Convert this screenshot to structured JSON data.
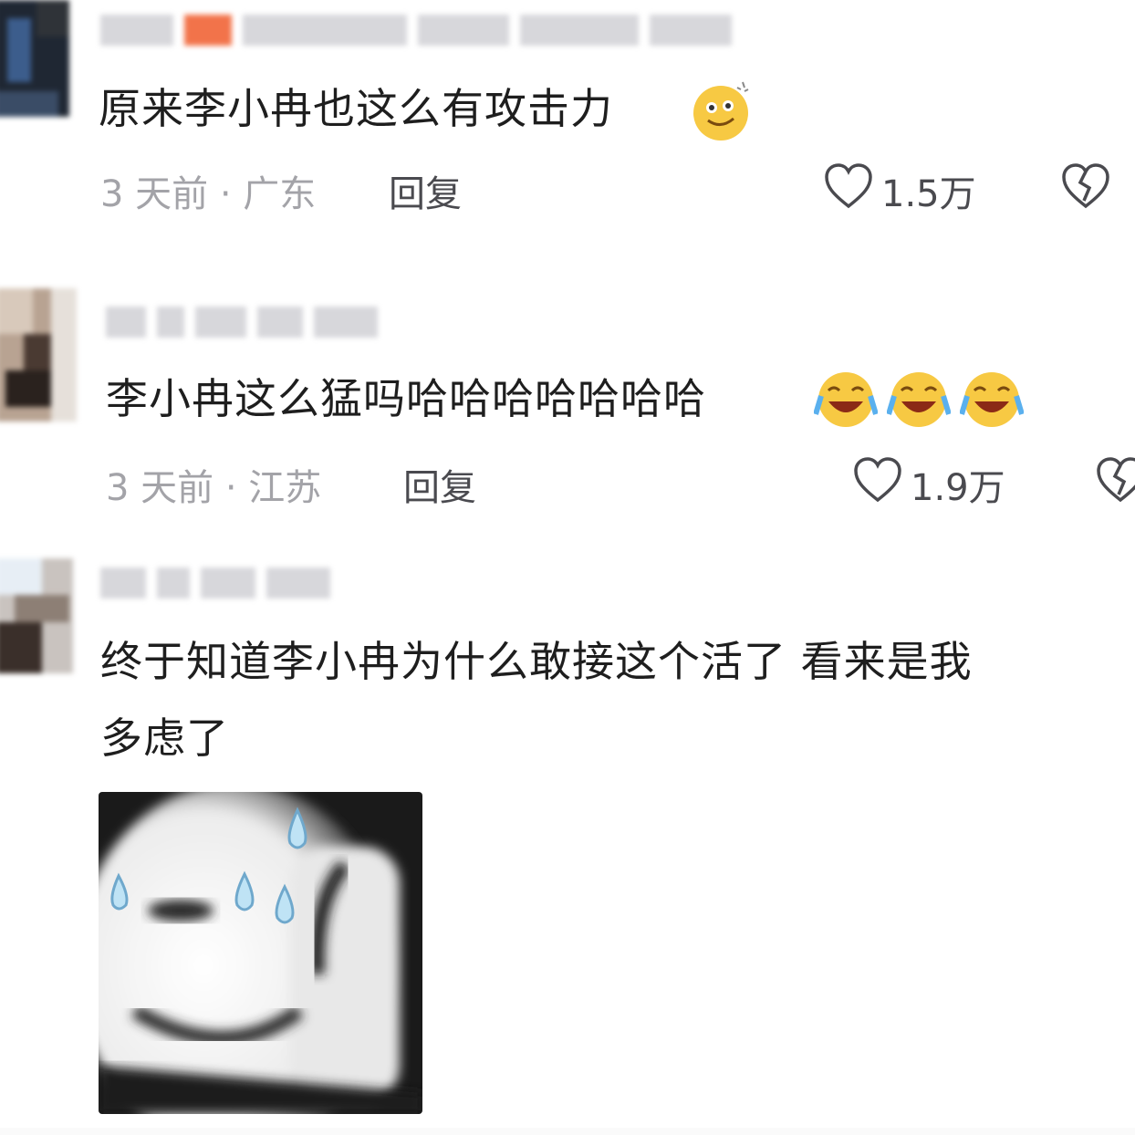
{
  "comments": [
    {
      "text": "原来李小冉也这么有攻击力",
      "time_location": "3 天前 · 广东",
      "reply_label": "回复",
      "like_count": "1.5万",
      "emoji": [
        "smile-sweat-icon"
      ]
    },
    {
      "text": "李小冉这么猛吗哈哈哈哈哈哈哈",
      "time_location": "3 天前 · 江苏",
      "reply_label": "回复",
      "like_count": "1.9万",
      "emoji": [
        "laugh-cry-icon",
        "laugh-cry-icon",
        "laugh-cry-icon"
      ]
    },
    {
      "text_line1": "终于知道李小冉为什么敢接这个活了 看来是我",
      "text_line2": "多虑了",
      "image": "sweating-meme-sticker"
    }
  ],
  "colors": {
    "text": "#1e1e1e",
    "meta": "#a3a3a8",
    "action": "#4a4a4f",
    "username_blur": "#d7d7db",
    "badge": "#f2734a"
  }
}
